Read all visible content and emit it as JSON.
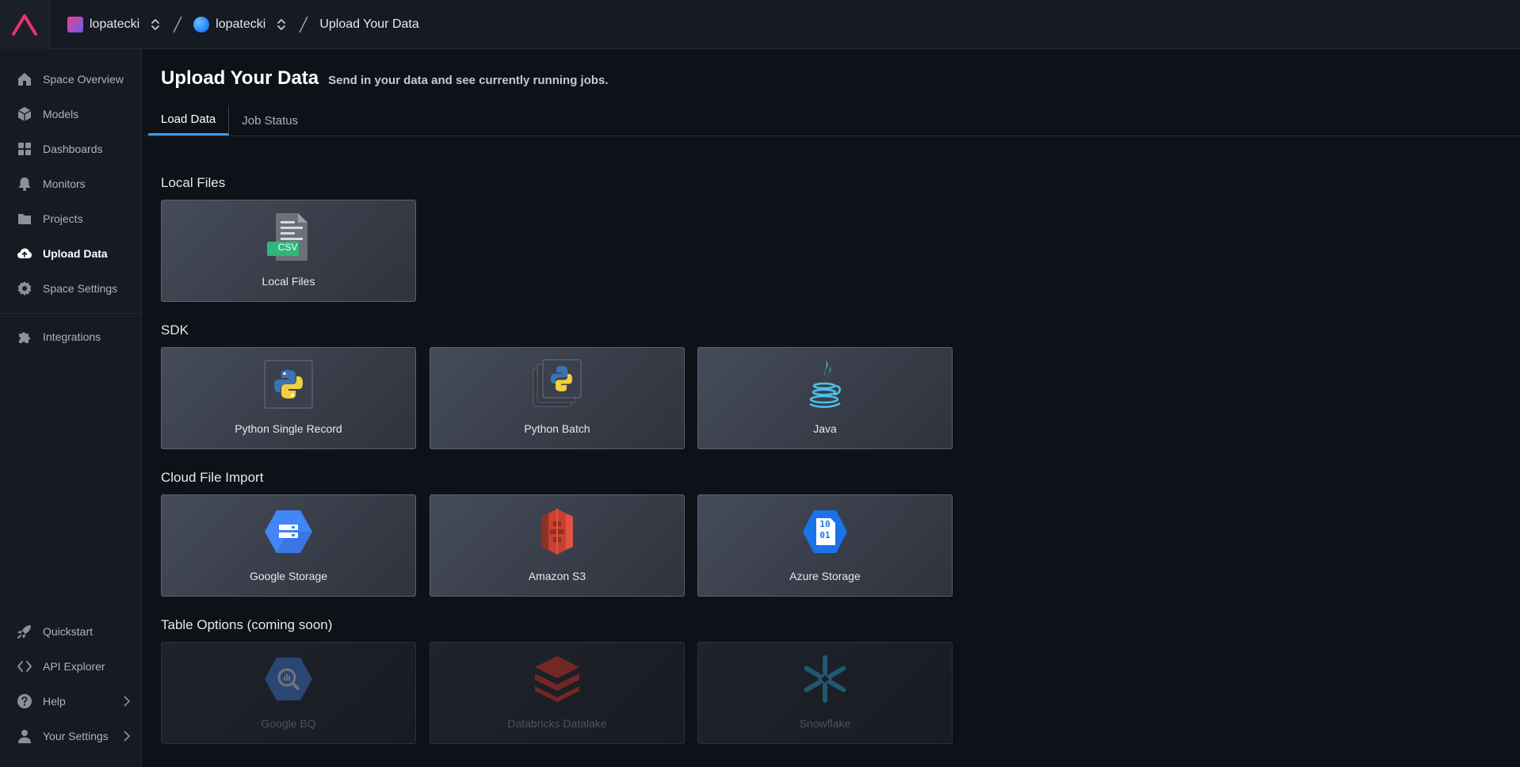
{
  "topbar": {
    "org_name": "lopatecki",
    "space_name": "lopatecki",
    "current_page": "Upload Your Data"
  },
  "sidebar": {
    "items": [
      {
        "label": "Space Overview",
        "icon": "home-icon"
      },
      {
        "label": "Models",
        "icon": "cube-icon"
      },
      {
        "label": "Dashboards",
        "icon": "grid-icon"
      },
      {
        "label": "Monitors",
        "icon": "bell-icon"
      },
      {
        "label": "Projects",
        "icon": "folder-icon"
      },
      {
        "label": "Upload Data",
        "icon": "cloud-upload-icon",
        "active": true
      },
      {
        "label": "Space Settings",
        "icon": "gear-icon"
      },
      {
        "label": "Integrations",
        "icon": "puzzle-icon"
      }
    ],
    "bottom_items": [
      {
        "label": "Quickstart",
        "icon": "rocket-icon"
      },
      {
        "label": "API Explorer",
        "icon": "code-icon"
      },
      {
        "label": "Help",
        "icon": "help-icon"
      },
      {
        "label": "Your Settings",
        "icon": "user-icon"
      }
    ]
  },
  "page": {
    "title": "Upload Your Data",
    "subtitle": "Send in your data and see currently running jobs."
  },
  "tabs": [
    {
      "label": "Load Data",
      "active": true
    },
    {
      "label": "Job Status",
      "active": false
    }
  ],
  "sections": {
    "local": {
      "title": "Local Files",
      "cards": [
        {
          "label": "Local Files",
          "badge": "CSV",
          "icon": "csv-file-icon"
        }
      ]
    },
    "sdk": {
      "title": "SDK",
      "cards": [
        {
          "label": "Python Single Record",
          "icon": "python-icon"
        },
        {
          "label": "Python Batch",
          "icon": "python-batch-icon"
        },
        {
          "label": "Java",
          "icon": "java-icon"
        }
      ]
    },
    "cloud": {
      "title": "Cloud File Import",
      "cards": [
        {
          "label": "Google Storage",
          "icon": "google-storage-icon"
        },
        {
          "label": "Amazon S3",
          "icon": "amazon-s3-icon"
        },
        {
          "label": "Azure Storage",
          "icon": "azure-storage-icon",
          "glyph_top": "10",
          "glyph_bottom": "01"
        }
      ]
    },
    "table": {
      "title": "Table Options (coming soon)",
      "cards": [
        {
          "label": "Google BQ",
          "icon": "bigquery-icon",
          "disabled": true
        },
        {
          "label": "Databricks Datalake",
          "icon": "databricks-icon",
          "disabled": true
        },
        {
          "label": "Snowflake",
          "icon": "snowflake-icon",
          "disabled": true
        }
      ]
    }
  },
  "colors": {
    "brand": "#e8336d",
    "accent": "#3d9be9",
    "csv_badge": "#2fb67c"
  }
}
